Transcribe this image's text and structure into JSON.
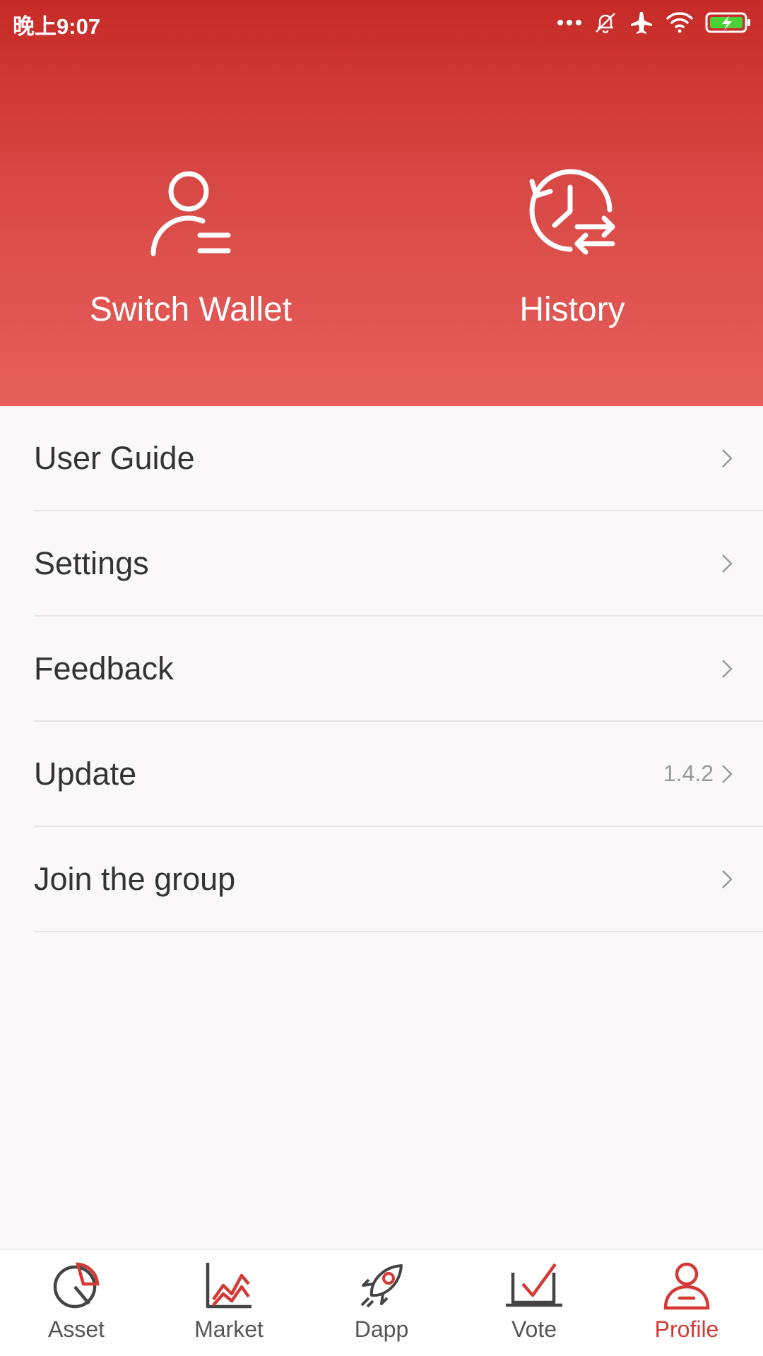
{
  "status_bar": {
    "time": "晚上9:07",
    "icons": [
      "more-dots-icon",
      "mute-icon",
      "airplane-mode-icon",
      "wifi-icon",
      "battery-charging-icon"
    ]
  },
  "header": {
    "switch_wallet": {
      "label": "Switch Wallet",
      "icon": "user-list-icon"
    },
    "history": {
      "label": "History",
      "icon": "history-clock-icon"
    }
  },
  "menu": {
    "items": [
      {
        "label": "User Guide",
        "value": ""
      },
      {
        "label": "Settings",
        "value": ""
      },
      {
        "label": "Feedback",
        "value": ""
      },
      {
        "label": "Update",
        "value": "1.4.2"
      },
      {
        "label": "Join the group",
        "value": ""
      }
    ]
  },
  "tabbar": {
    "active": "Profile",
    "tabs": [
      {
        "label": "Asset",
        "icon": "pie-chart-icon"
      },
      {
        "label": "Market",
        "icon": "line-chart-icon"
      },
      {
        "label": "Dapp",
        "icon": "rocket-icon"
      },
      {
        "label": "Vote",
        "icon": "checkmark-board-icon"
      },
      {
        "label": "Profile",
        "icon": "profile-icon"
      }
    ]
  },
  "colors": {
    "header_top": "#c62a26",
    "header_bottom": "#e65f5b",
    "accent": "#d33a36",
    "battery": "#4cd137"
  }
}
